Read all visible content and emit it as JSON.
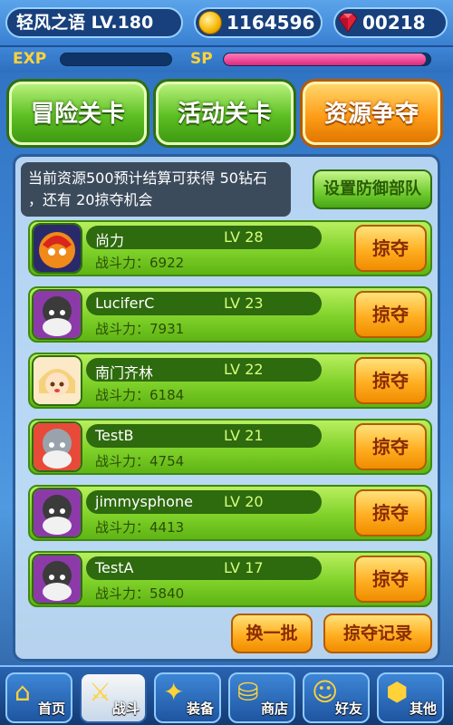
{
  "header": {
    "player_name_level": "轻风之语 LV.180",
    "coins": "1164596",
    "gems": "00218",
    "exp_label": "EXP",
    "sp_label": "SP",
    "exp_fill_fraction": 0.0,
    "sp_fill_fraction": 0.98
  },
  "tabs": [
    {
      "label": "冒险关卡"
    },
    {
      "label": "活动关卡"
    },
    {
      "label": "资源争夺"
    }
  ],
  "info": {
    "text_line1": "当前资源500预计结算可获得 50钻石",
    "text_line2": "，还有 20掠夺机会",
    "defense_button": "设置防御部队"
  },
  "opponents": [
    {
      "name": "尚力",
      "level": "LV 28",
      "power": "战斗力：6922",
      "action": "掠夺"
    },
    {
      "name": "LuciferC",
      "level": "LV 23",
      "power": "战斗力：7931",
      "action": "掠夺"
    },
    {
      "name": "南门齐林",
      "level": "LV 22",
      "power": "战斗力：6184",
      "action": "掠夺"
    },
    {
      "name": "TestB",
      "level": "LV 21",
      "power": "战斗力：4754",
      "action": "掠夺"
    },
    {
      "name": "jimmysphone",
      "level": "LV 20",
      "power": "战斗力：4413",
      "action": "掠夺"
    },
    {
      "name": "TestA",
      "level": "LV 17",
      "power": "战斗力：5840",
      "action": "掠夺"
    }
  ],
  "actions": {
    "refresh": "换一批",
    "history": "掠夺记录"
  },
  "nav": [
    {
      "label": "首页",
      "icon": "home-icon"
    },
    {
      "label": "战斗",
      "icon": "battle-icon"
    },
    {
      "label": "装备",
      "icon": "equipment-icon"
    },
    {
      "label": "商店",
      "icon": "shop-icon"
    },
    {
      "label": "好友",
      "icon": "friends-icon"
    },
    {
      "label": "其他",
      "icon": "other-icon"
    }
  ]
}
